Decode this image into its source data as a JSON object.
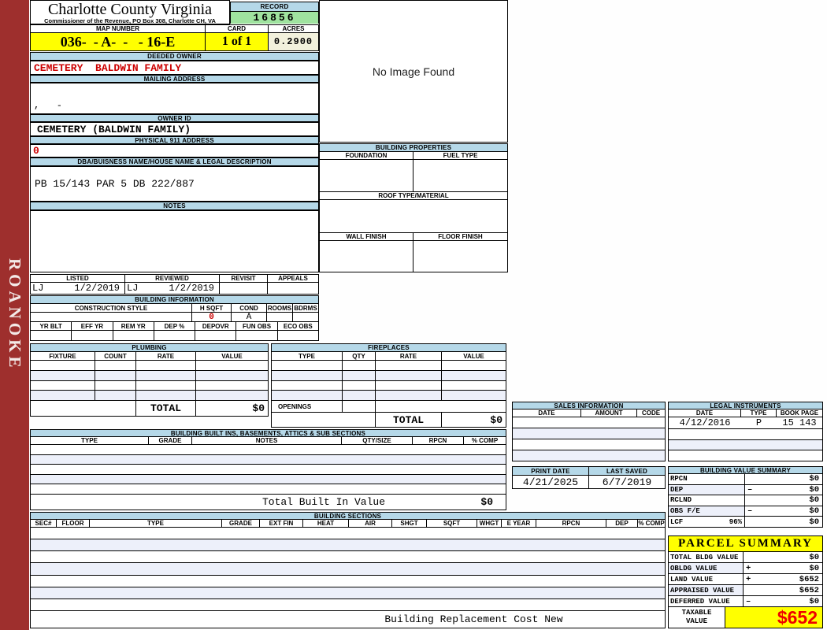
{
  "sidebar": {
    "text": "ROANOKE"
  },
  "header": {
    "title": "Charlotte County Virginia",
    "subtitle": "Commissioner of the Revenue, PO Box 308, Charlotte CH, VA",
    "record_label": "RECORD",
    "record_value": "16856",
    "map_label": "MAP NUMBER",
    "map_value": "036-  - A-  -   - 16-E",
    "card_label": "CARD",
    "card_value": "1 of 1",
    "acres_label": "ACRES",
    "acres_value": "0.2900"
  },
  "image_box": {
    "text": "No Image Found"
  },
  "owner": {
    "deeded_label": "DEEDED OWNER",
    "deeded_value": "CEMETERY  BALDWIN FAMILY",
    "mailing_label": "MAILING ADDRESS",
    "mailing_value": ",   -",
    "owner_id_label": "OWNER ID",
    "owner_id_value": "CEMETERY (BALDWIN FAMILY)",
    "physical_label": "PHYSICAL 911 ADDRESS",
    "physical_value": "0",
    "dba_label": "DBA/BUISNESS NAME/HOUSE NAME & LEGAL DESCRIPTION",
    "dba_value": "PB 15/143 PAR 5 DB 222/887",
    "notes_label": "NOTES"
  },
  "building_properties": {
    "title": "BUILDING PROPERTIES",
    "foundation_label": "FOUNDATION",
    "fuel_label": "FUEL TYPE",
    "roof_label": "ROOF TYPE/MATERIAL",
    "wall_label": "WALL FINISH",
    "floor_label": "FLOOR FINISH"
  },
  "review": {
    "headers": [
      "LISTED",
      "REVIEWED",
      "REVISIT",
      "APPEALS"
    ],
    "listed_by": "LJ",
    "listed_date": "1/2/2019",
    "reviewed_by": "LJ",
    "reviewed_date": "1/2/2019"
  },
  "building_info": {
    "title": "BUILDING INFORMATION",
    "row1_headers": [
      "CONSTRUCTION STYLE",
      "H SQFT",
      "COND",
      "ROOMS",
      "BDRMS"
    ],
    "hsqft_value": "0",
    "cond_value": "A",
    "row2_headers": [
      "YR BLT",
      "EFF YR",
      "REM YR",
      "DEP %",
      "DEPOVR",
      "FUN OBS",
      "ECO OBS"
    ]
  },
  "plumbing": {
    "title": "PLUMBING",
    "headers": [
      "FIXTURE",
      "COUNT",
      "RATE",
      "VALUE"
    ],
    "total_label": "TOTAL",
    "total_value": "$0"
  },
  "fireplaces": {
    "title": "FIREPLACES",
    "headers": [
      "TYPE",
      "QTY",
      "RATE",
      "VALUE"
    ],
    "openings_label": "OPENINGS",
    "total_label": "TOTAL",
    "total_value": "$0"
  },
  "built_ins": {
    "title": "BUILDING BUILT INS, BASEMENTS, ATTICS & SUB SECTIONS",
    "headers": [
      "TYPE",
      "GRADE",
      "NOTES",
      "QTY/SIZE",
      "RPCN",
      "% COMP"
    ],
    "total_label": "Total Built In Value",
    "total_value": "$0"
  },
  "building_sections": {
    "title": "BUILDING SECTIONS",
    "headers": [
      "SEC#",
      "FLOOR",
      "TYPE",
      "GRADE",
      "EXT FIN",
      "HEAT",
      "AIR",
      "SHGT",
      "SQFT",
      "WHGT",
      "E YEAR",
      "RPCN",
      "DEP",
      "% COMP"
    ],
    "footer": "Building Replacement Cost New"
  },
  "sales": {
    "title": "SALES INFORMATION",
    "headers": [
      "DATE",
      "AMOUNT",
      "CODE"
    ]
  },
  "legal": {
    "title": "LEGAL INSTRUMENTS",
    "headers": [
      "DATE",
      "TYPE",
      "BOOK PAGE"
    ],
    "rows": [
      {
        "date": "4/12/2016",
        "type": "P",
        "book_page": "15 143"
      }
    ]
  },
  "dates": {
    "print_label": "PRINT DATE",
    "print_value": "4/21/2025",
    "saved_label": "LAST SAVED",
    "saved_value": "6/7/2019"
  },
  "value_summary": {
    "title": "BUILDING VALUE SUMMARY",
    "rows": [
      {
        "label": "RPCN",
        "pct": "",
        "op": "",
        "value": "$0"
      },
      {
        "label": "DEP",
        "pct": "",
        "op": "–",
        "value": "$0"
      },
      {
        "label": "RCLND",
        "pct": "",
        "op": "",
        "value": "$0"
      },
      {
        "label": "OBS F/E",
        "pct": "",
        "op": "–",
        "value": "$0"
      },
      {
        "label": "LCF",
        "pct": "96%",
        "op": "",
        "value": "$0"
      }
    ]
  },
  "parcel_summary": {
    "title": "PARCEL SUMMARY",
    "rows": [
      {
        "label": "TOTAL BLDG VALUE",
        "op": "",
        "value": "$0"
      },
      {
        "label": "OBLDG VALUE",
        "op": "+",
        "value": "$0"
      },
      {
        "label": "LAND VALUE",
        "op": "+",
        "value": "$652"
      },
      {
        "label": "APPRAISED VALUE",
        "op": "",
        "value": "$652"
      },
      {
        "label": "DEFERRED VALUE",
        "op": "–",
        "value": "$0"
      }
    ],
    "taxable_label": "TAXABLE\nVALUE",
    "taxable_value": "$652"
  },
  "colors": {
    "header_blue": "#b5d8e8",
    "record_green": "#9fe39f",
    "yellow": "#ffff00",
    "cream": "#f2f1dc",
    "sidebar_red": "#9e2f2d",
    "value_red": "#cc0000",
    "taxable_red": "#ee0000",
    "alt_row": "#edf0fa"
  }
}
